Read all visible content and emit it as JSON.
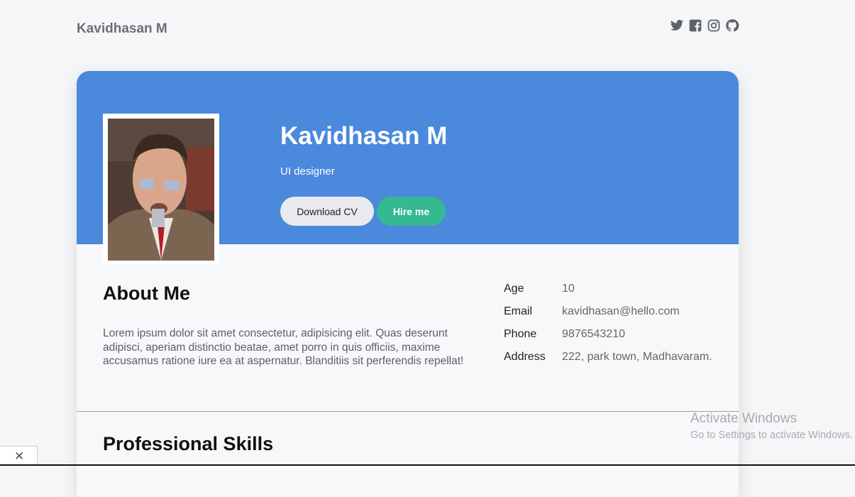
{
  "header": {
    "brand": "Kavidhasan M",
    "social_icons": [
      "twitter-icon",
      "facebook-icon",
      "instagram-icon",
      "github-icon"
    ]
  },
  "profile": {
    "name": "Kavidhasan M",
    "role": "UI designer",
    "buttons": {
      "download_cv": "Download CV",
      "hire_me": "Hire me"
    }
  },
  "about": {
    "title": "About Me",
    "text": "Lorem ipsum dolor sit amet consectetur, adipisicing elit. Quas deserunt adipisci, aperiam distinctio beatae, amet porro in quis officiis, maxime accusamus ratione iure ea at aspernatur. Blanditiis sit perferendis repellat!"
  },
  "details": [
    {
      "label": "Age",
      "value": "10"
    },
    {
      "label": "Email",
      "value": "kavidhasan@hello.com"
    },
    {
      "label": "Phone",
      "value": "9876543210"
    },
    {
      "label": "Address",
      "value": "222, park town, Madhavaram."
    }
  ],
  "skills": {
    "title": "Professional Skills"
  },
  "os_overlay": {
    "watermark_title": "Activate Windows",
    "watermark_sub": "Go to Settings to activate Windows."
  },
  "colors": {
    "hero": "#4a89dc",
    "hire_button": "#35b990",
    "cv_button": "#e9e9ee"
  }
}
